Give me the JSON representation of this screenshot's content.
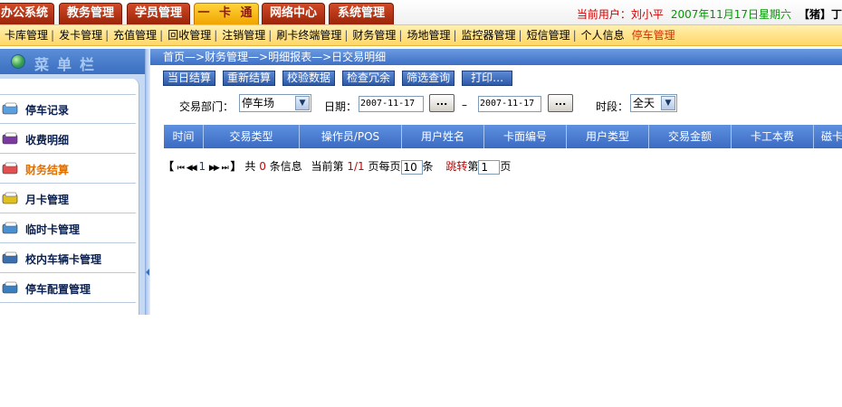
{
  "top_tabs": [
    {
      "label": "办公系统"
    },
    {
      "label": "教务管理"
    },
    {
      "label": "学员管理"
    },
    {
      "label": "一 卡 通"
    },
    {
      "label": "网络中心"
    },
    {
      "label": "系统管理"
    }
  ],
  "user_bar": {
    "current_user": "当前用户：刘小平",
    "date": "2007年11月17日星期六",
    "logout": "【猪】丁"
  },
  "sub_menu": [
    {
      "label": "卡库管理"
    },
    {
      "label": "发卡管理"
    },
    {
      "label": "充值管理"
    },
    {
      "label": "回收管理"
    },
    {
      "label": "注销管理"
    },
    {
      "label": "刷卡终端管理"
    },
    {
      "label": "财务管理"
    },
    {
      "label": "场地管理"
    },
    {
      "label": "监控器管理"
    },
    {
      "label": "短信管理"
    },
    {
      "label": "个人信息"
    },
    {
      "label": "停车管理"
    }
  ],
  "sidebar": {
    "title": "菜单栏",
    "items": [
      {
        "label": "停车记录",
        "icon": "car-icon"
      },
      {
        "label": "收费明细",
        "icon": "card-icon"
      },
      {
        "label": "财务结算",
        "icon": "wallet-icon"
      },
      {
        "label": "月卡管理",
        "icon": "monthly-card-icon"
      },
      {
        "label": "临时卡管理",
        "icon": "temp-card-icon"
      },
      {
        "label": "校内车辆卡管理",
        "icon": "campus-car-icon"
      },
      {
        "label": "停车配置管理",
        "icon": "config-icon"
      }
    ]
  },
  "breadcrumb": "首页—>财务管理—>明细报表—>日交易明细",
  "toolbar": [
    {
      "label": "当日结算"
    },
    {
      "label": "重新结算"
    },
    {
      "label": "校验数据"
    },
    {
      "label": "检查冗余"
    },
    {
      "label": "筛选查询"
    },
    {
      "label": "打印…"
    }
  ],
  "filters": {
    "dept_label": "交易部门：",
    "dept_value": "停车场",
    "date_label": "日期：",
    "date_from": "2007-11-17",
    "date_to": "2007-11-17",
    "date_dash": "–",
    "browse": "...",
    "period_label": "时段：",
    "period_value": "全天"
  },
  "table": {
    "columns": [
      "时间",
      "交易类型",
      "操作员/POS",
      "用户姓名",
      "卡面编号",
      "用户类型",
      "交易金额",
      "卡工本费",
      "磁卡"
    ]
  },
  "pager": {
    "open_bracket": "【",
    "close_bracket": "】",
    "first": "⏮",
    "prev": "◀◀",
    "current_page": "1",
    "next": "▶▶",
    "last": "⏭",
    "total_prefix": "共",
    "total_count": "0",
    "total_suffix": "条信息",
    "page_prefix": "当前第",
    "page_value": "1/1",
    "page_suffix": "页",
    "per_page_label": "每页",
    "per_page_value": "10",
    "per_page_suffix": "条",
    "jump_label": "跳转",
    "jump_prefix": "第",
    "jump_value": "1",
    "jump_suffix": "页"
  }
}
